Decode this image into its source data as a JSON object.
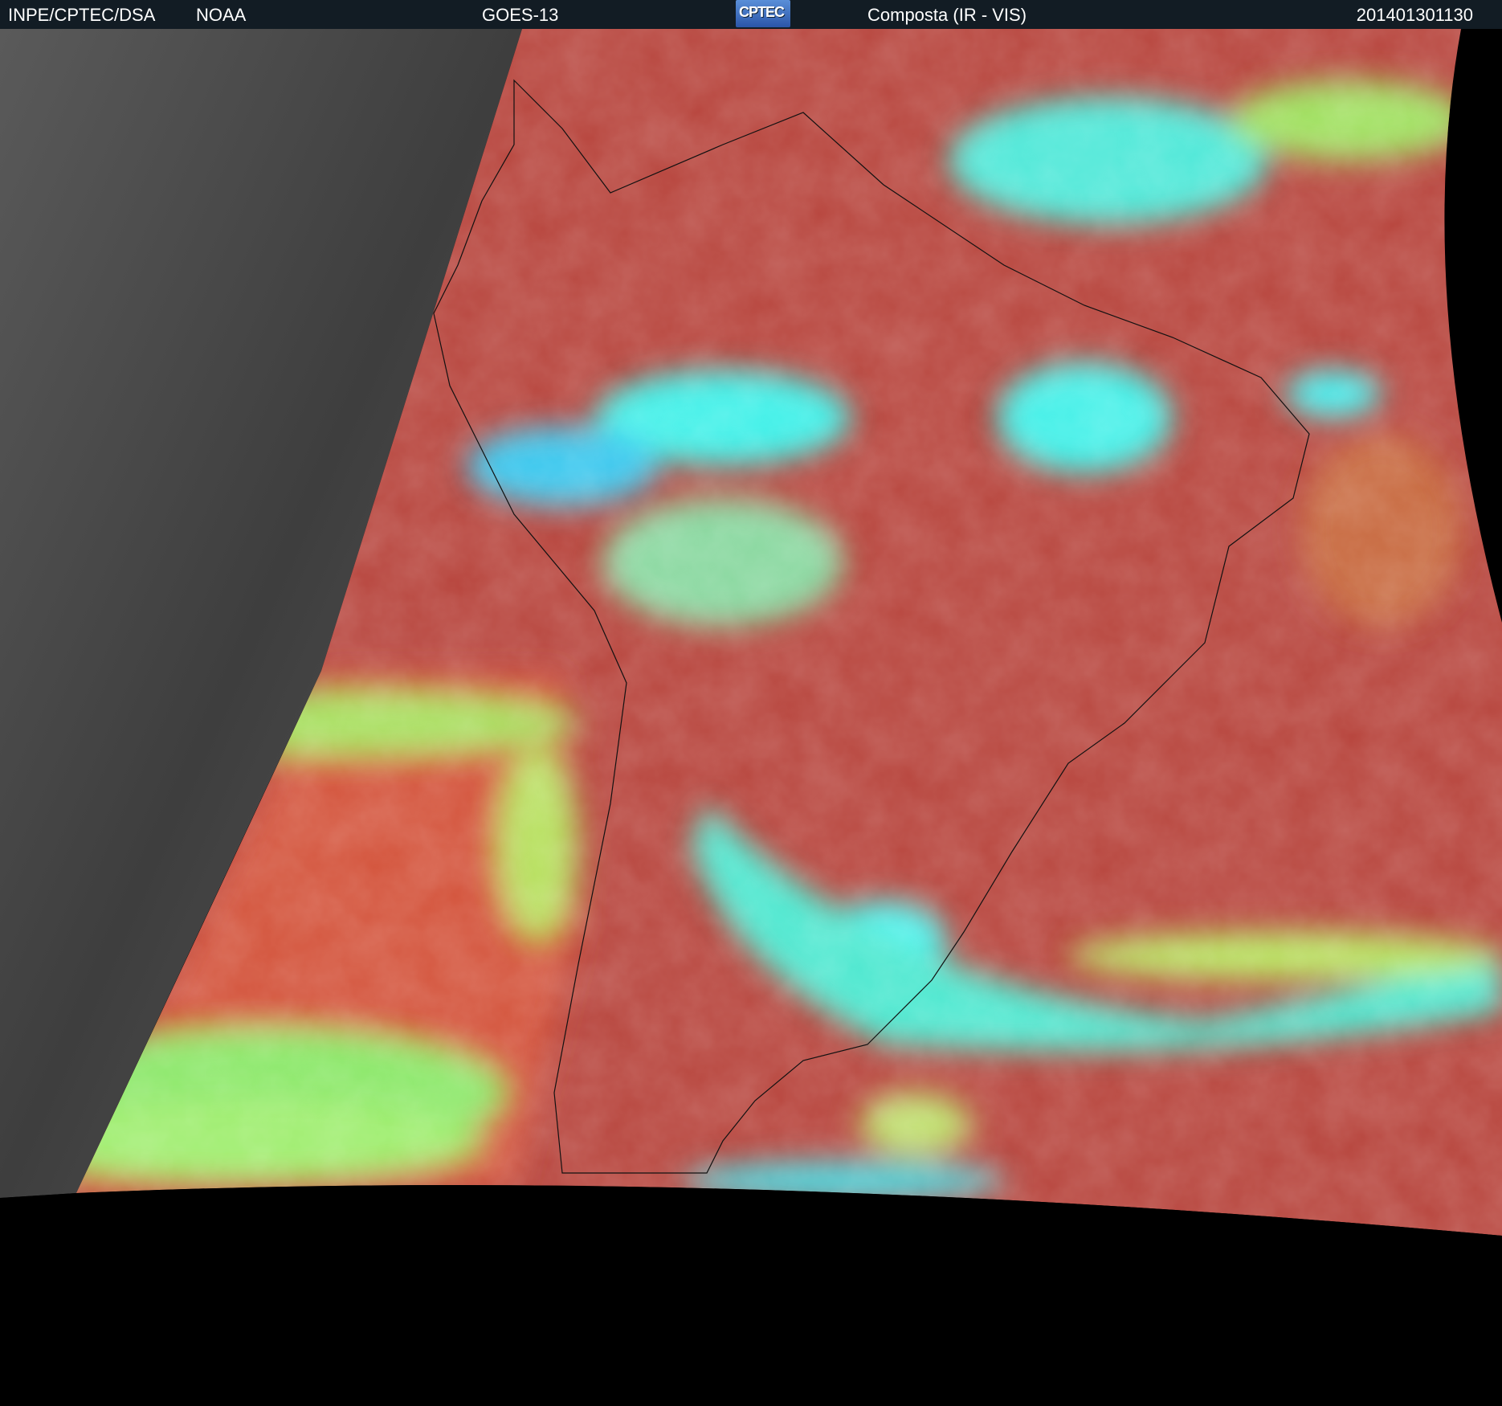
{
  "header": {
    "agency": "INPE/CPTEC/DSA",
    "source": "NOAA",
    "satellite": "GOES-13",
    "logo_text": "CPTEC",
    "product": "Composta (IR - VIS)",
    "timestamp": "201401301130"
  },
  "colors": {
    "header_bg": "#121c24",
    "ir_red": "#b8463e",
    "cloud_cyan": "#3ef0e6",
    "cloud_green": "#9ef06a",
    "night_gray": "#4a4a4a"
  }
}
